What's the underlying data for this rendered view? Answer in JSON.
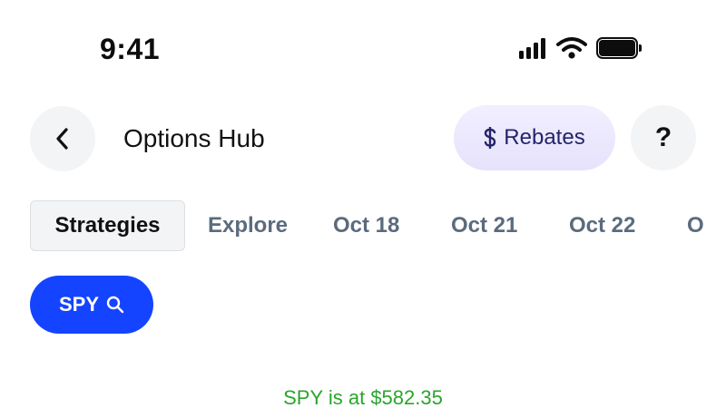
{
  "status_bar": {
    "time": "9:41",
    "icons": [
      "cellular-signal-icon",
      "wifi-icon",
      "battery-icon"
    ]
  },
  "header": {
    "back_icon": "chevron-left-icon",
    "title": "Options Hub",
    "rebates_label": "Rebates",
    "rebates_icon": "dollar-icon",
    "help_label": "?"
  },
  "tabs": [
    {
      "label": "Strategies",
      "active": true
    },
    {
      "label": "Explore",
      "active": false
    },
    {
      "label": "Oct 18",
      "active": false
    },
    {
      "label": "Oct 21",
      "active": false
    },
    {
      "label": "Oct 22",
      "active": false
    }
  ],
  "symbol": {
    "label": "SPY",
    "icon": "search-icon"
  },
  "price_text": "SPY is at $582.35",
  "colors": {
    "accent_blue": "#1444ff",
    "rebates_bg": "#ece9fc",
    "rebates_text": "#24246b",
    "price_green": "#2aa52a",
    "tab_inactive": "#5b6b7d"
  }
}
